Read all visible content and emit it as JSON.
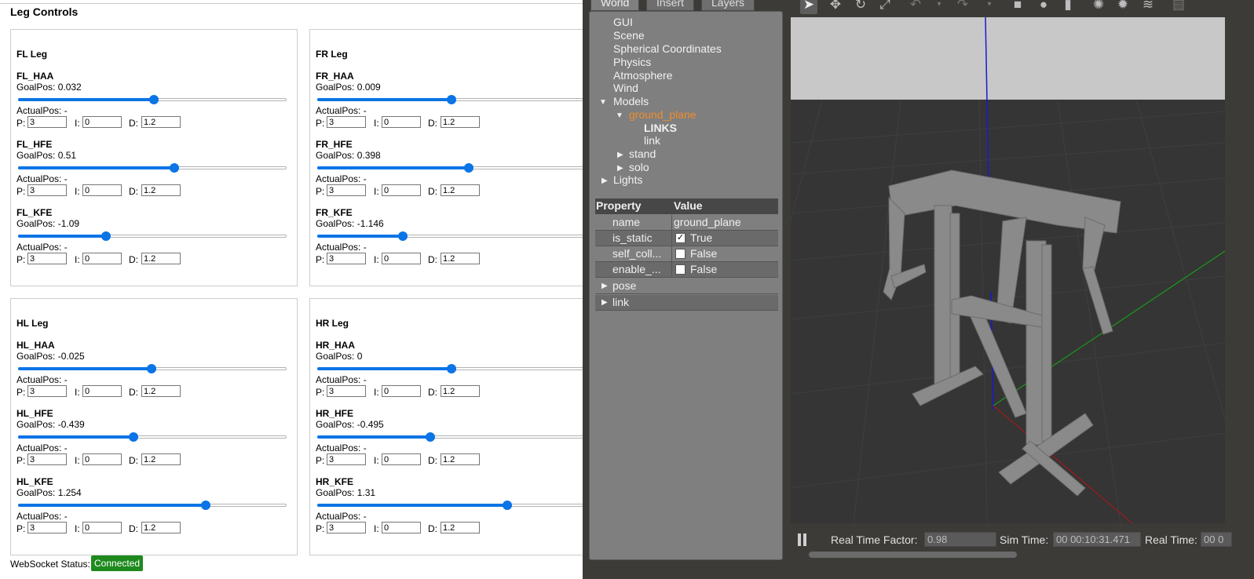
{
  "web": {
    "title": "Leg Controls",
    "legs": [
      {
        "title": "FL Leg",
        "joints": [
          {
            "name": "FL_HAA",
            "goal": "GoalPos: 0.032",
            "value": 0.032,
            "actual": "ActualPos: -",
            "p": "3",
            "i": "0",
            "d": "1.2"
          },
          {
            "name": "FL_HFE",
            "goal": "GoalPos: 0.51",
            "value": 0.51,
            "actual": "ActualPos: -",
            "p": "3",
            "i": "0",
            "d": "1.2"
          },
          {
            "name": "FL_KFE",
            "goal": "GoalPos: -1.09",
            "value": -1.09,
            "actual": "ActualPos: -",
            "p": "3",
            "i": "0",
            "d": "1.2"
          }
        ]
      },
      {
        "title": "FR Leg",
        "joints": [
          {
            "name": "FR_HAA",
            "goal": "GoalPos: 0.009",
            "value": 0.009,
            "actual": "ActualPos: -",
            "p": "3",
            "i": "0",
            "d": "1.2"
          },
          {
            "name": "FR_HFE",
            "goal": "GoalPos: 0.398",
            "value": 0.398,
            "actual": "ActualPos: -",
            "p": "3",
            "i": "0",
            "d": "1.2"
          },
          {
            "name": "FR_KFE",
            "goal": "GoalPos: -1.146",
            "value": -1.146,
            "actual": "ActualPos: -",
            "p": "3",
            "i": "0",
            "d": "1.2"
          }
        ]
      },
      {
        "title": "HL Leg",
        "joints": [
          {
            "name": "HL_HAA",
            "goal": "GoalPos: -0.025",
            "value": -0.025,
            "actual": "ActualPos: -",
            "p": "3",
            "i": "0",
            "d": "1.2"
          },
          {
            "name": "HL_HFE",
            "goal": "GoalPos: -0.439",
            "value": -0.439,
            "actual": "ActualPos: -",
            "p": "3",
            "i": "0",
            "d": "1.2"
          },
          {
            "name": "HL_KFE",
            "goal": "GoalPos: 1.254",
            "value": 1.254,
            "actual": "ActualPos: -",
            "p": "3",
            "i": "0",
            "d": "1.2"
          }
        ]
      },
      {
        "title": "HR Leg",
        "joints": [
          {
            "name": "HR_HAA",
            "goal": "GoalPos: 0",
            "value": 0,
            "actual": "ActualPos: -",
            "p": "3",
            "i": "0",
            "d": "1.2"
          },
          {
            "name": "HR_HFE",
            "goal": "GoalPos: -0.495",
            "value": -0.495,
            "actual": "ActualPos: -",
            "p": "3",
            "i": "0",
            "d": "1.2"
          },
          {
            "name": "HR_KFE",
            "goal": "GoalPos: 1.31",
            "value": 1.31,
            "actual": "ActualPos: -",
            "p": "3",
            "i": "0",
            "d": "1.2"
          }
        ]
      }
    ],
    "slider_range": [
      -3.14,
      3.14
    ],
    "pid_labels": {
      "p": "P:",
      "i": "I:",
      "d": "D:"
    },
    "ws_label": "WebSocket Status:",
    "ws_status": "Connected",
    "ws_color": "#1e8a1e",
    "accent": "#0b74e6"
  },
  "gazebo": {
    "tabs": [
      "World",
      "Insert",
      "Layers"
    ],
    "tree": {
      "gui": "GUI",
      "scene": "Scene",
      "spherical": "Spherical Coordinates",
      "physics": "Physics",
      "atmosphere": "Atmosphere",
      "wind": "Wind",
      "models": "Models",
      "ground_plane": "ground_plane",
      "links": "LINKS",
      "link": "link",
      "stand": "stand",
      "solo": "solo",
      "lights": "Lights"
    },
    "props": {
      "h_prop": "Property",
      "h_val": "Value",
      "rows": [
        {
          "k": "name",
          "v": "ground_plane"
        },
        {
          "k": "is_static",
          "v": "True",
          "checked": "✓"
        },
        {
          "k": "self_coll...",
          "v": "False",
          "checked": ""
        },
        {
          "k": "enable_...",
          "v": "False",
          "checked": ""
        },
        {
          "k": "pose",
          "v": ""
        },
        {
          "k": "link",
          "v": ""
        }
      ]
    },
    "toolbar_icons": [
      "select-arrow-icon",
      "translate-icon",
      "rotate-icon",
      "scale-icon",
      "undo-icon",
      "undo-dropdown-icon",
      "redo-icon",
      "redo-dropdown-icon",
      "box-icon",
      "sphere-icon",
      "cylinder-icon",
      "point-light-icon",
      "spot-light-icon",
      "directional-light-icon",
      "copy-icon"
    ],
    "status": {
      "rtf_label": "Real Time Factor:",
      "rtf": "0.98",
      "sim_label": "Sim Time:",
      "sim": "00 00:10:31.471",
      "real_label": "Real Time:",
      "real": "00 0"
    },
    "highlight_color": "#f08c2a"
  }
}
